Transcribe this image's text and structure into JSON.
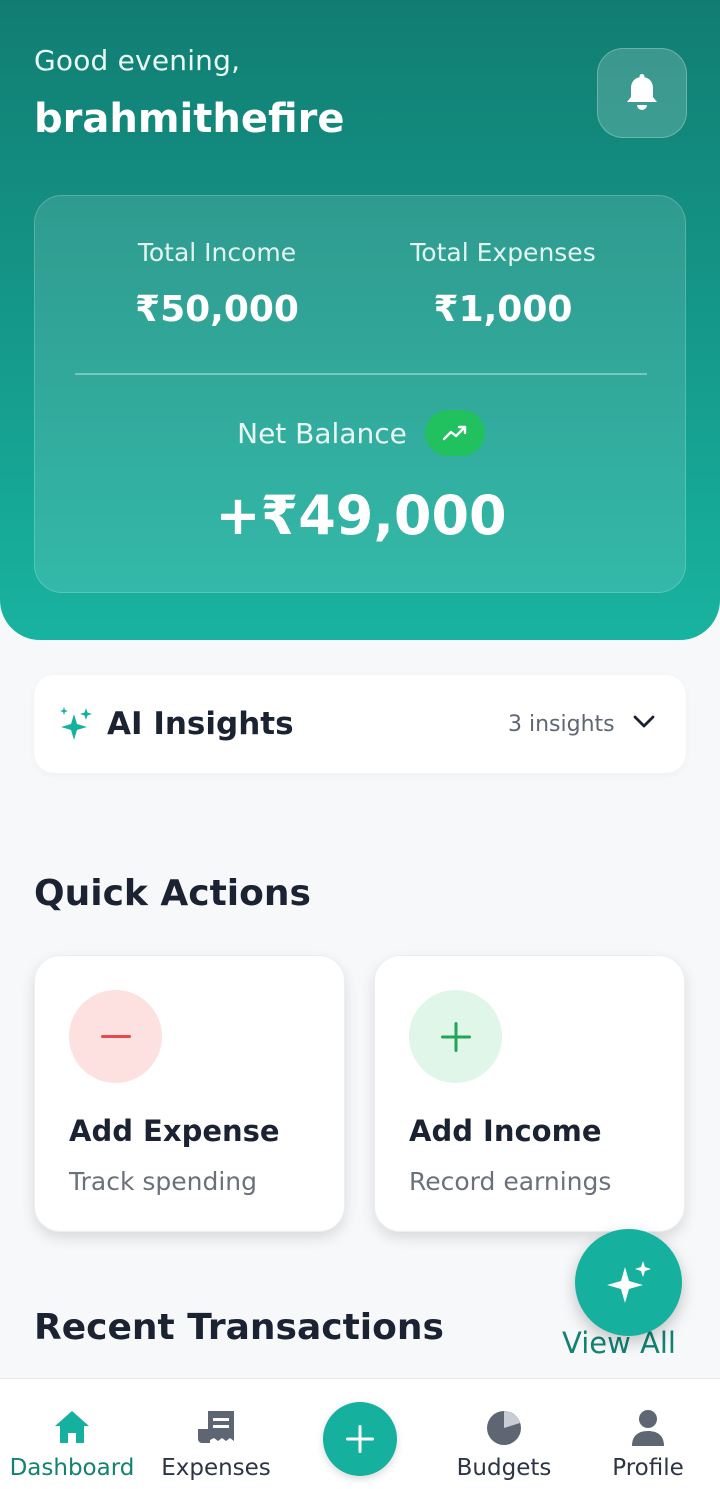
{
  "header": {
    "greeting": "Good evening,",
    "username": "brahmithefire",
    "notification_icon": "bell-icon"
  },
  "summary": {
    "income_label": "Total Income",
    "income_value": "₹50,000",
    "expenses_label": "Total Expenses",
    "expenses_value": "₹1,000",
    "net_label": "Net Balance",
    "net_value": "+₹49,000",
    "trend_icon": "trending-up-icon"
  },
  "insights": {
    "title": "AI Insights",
    "count": "3 insights",
    "icon": "sparkles-icon"
  },
  "quick_actions": {
    "title": "Quick Actions",
    "items": [
      {
        "title": "Add Expense",
        "subtitle": "Track spending",
        "icon": "minus-icon",
        "color": "#e5484d",
        "bg": "#fde1e1"
      },
      {
        "title": "Add Income",
        "subtitle": "Record earnings",
        "icon": "plus-icon",
        "color": "#22a55a",
        "bg": "#e0f6e8"
      }
    ]
  },
  "recent": {
    "title": "Recent Transactions",
    "view_all": "View All"
  },
  "nav": {
    "items": [
      {
        "label": "Dashboard",
        "icon": "home-icon",
        "active": true
      },
      {
        "label": "Expenses",
        "icon": "receipt-icon",
        "active": false
      },
      {
        "label": "Budgets",
        "icon": "pie-chart-icon",
        "active": false
      },
      {
        "label": "Profile",
        "icon": "user-icon",
        "active": false
      }
    ],
    "add_icon": "plus-icon"
  },
  "colors": {
    "primary": "#16b19e",
    "primary_dark": "#117d72",
    "success": "#21c15f"
  }
}
